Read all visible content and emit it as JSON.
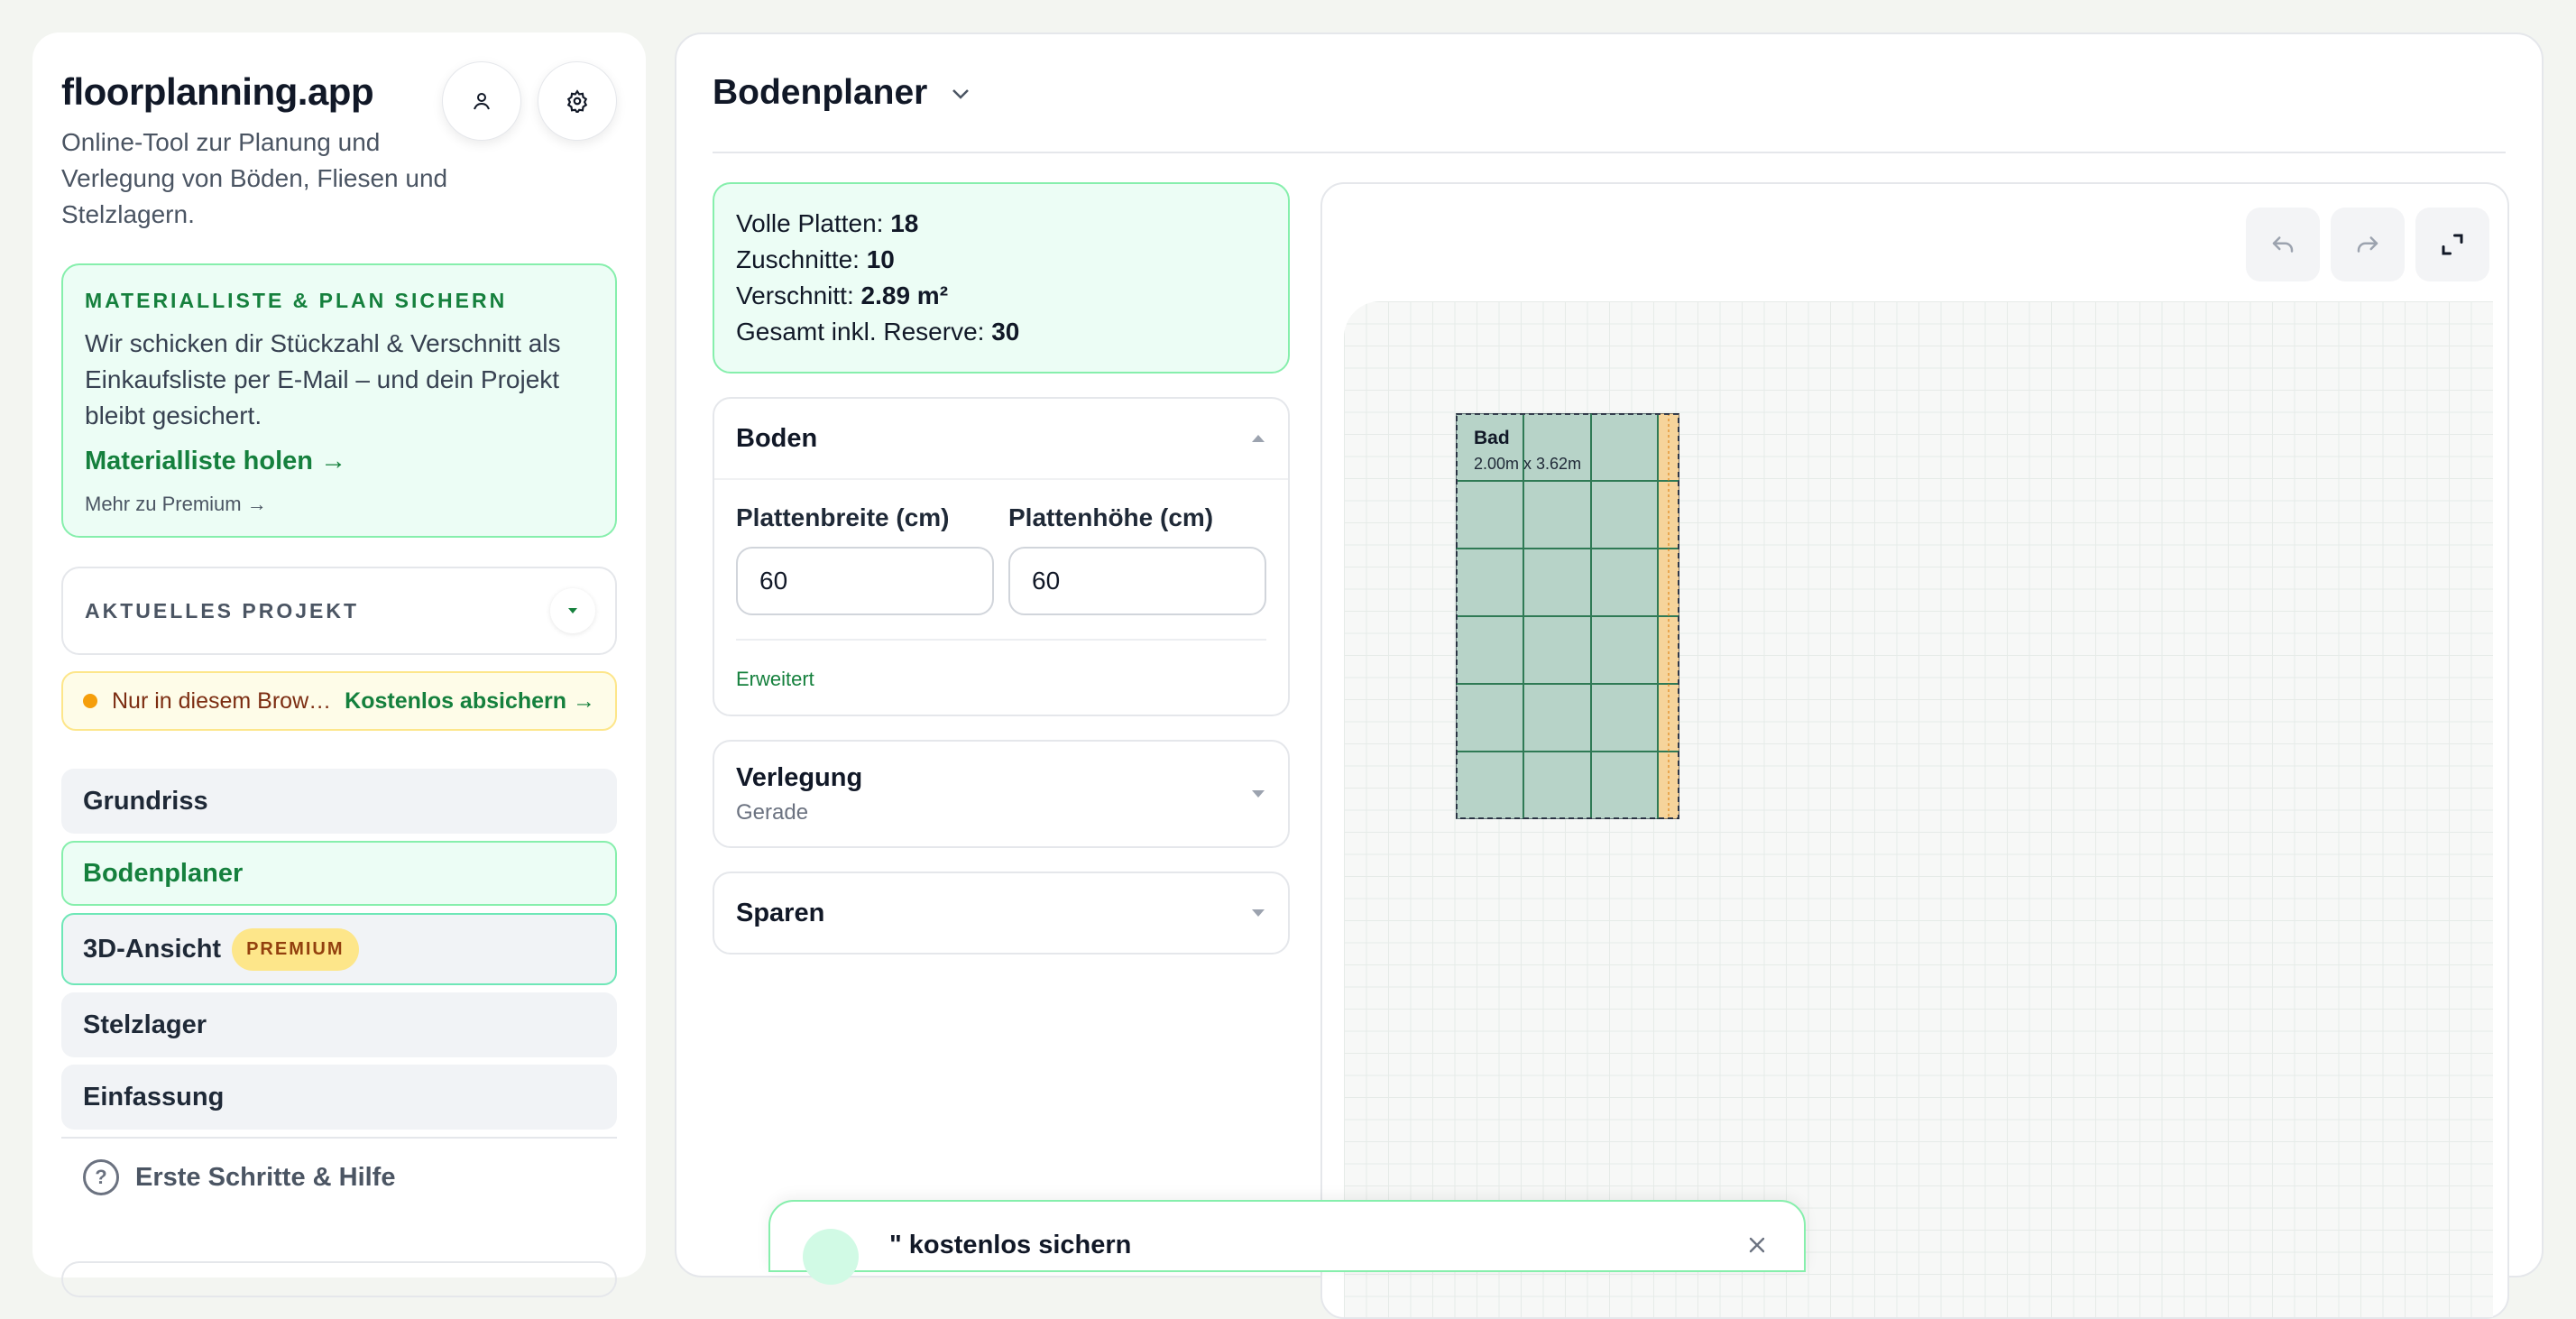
{
  "sidebar": {
    "brand_title": "floorplanning.app",
    "brand_subtitle": "Online-Tool zur Planung und Verlegung von Böden, Fliesen und Stelzlagern.",
    "promo": {
      "title": "MATERIALLISTE & PLAN SICHERN",
      "text": "Wir schicken dir Stückzahl & Verschnitt als Einkaufsliste per E-Mail – und dein Projekt bleibt gesichert.",
      "link": "Materialliste holen →",
      "small_link": "Mehr zu Premium →"
    },
    "project_label": "AKTUELLES PROJEKT",
    "warning": {
      "text": "Nur in diesem Brow…",
      "link": "Kostenlos absichern →"
    },
    "nav": [
      {
        "label": "Grundriss"
      },
      {
        "label": "Bodenplaner"
      },
      {
        "label": "3D-Ansicht",
        "badge": "PREMIUM"
      },
      {
        "label": "Stelzlager"
      },
      {
        "label": "Einfassung"
      }
    ],
    "help": "Erste Schritte & Hilfe"
  },
  "main": {
    "title": "Bodenplaner",
    "stats": {
      "full_label": "Volle Platten:",
      "full_value": "18",
      "cuts_label": "Zuschnitte:",
      "cuts_value": "10",
      "waste_label": "Verschnitt:",
      "waste_value": "2.89 m²",
      "total_label": "Gesamt inkl. Reserve:",
      "total_value": "30"
    },
    "panels": {
      "boden": {
        "title": "Boden",
        "width_label": "Plattenbreite (cm)",
        "width_value": "60",
        "height_label": "Plattenhöhe (cm)",
        "height_value": "60",
        "advanced": "Erweitert"
      },
      "verlegung": {
        "title": "Verlegung",
        "value": "Gerade"
      },
      "sparen": {
        "title": "Sparen"
      }
    },
    "canvas": {
      "room_name": "Bad",
      "room_dims": "2.00m x 3.62m",
      "tile_color": "#b7d3c8",
      "cut_color": "#f6d49b",
      "grid_line_color": "#2f7a55"
    },
    "toast": {
      "text": "\" kostenlos sichern"
    }
  },
  "colors": {
    "accent": "#15803d",
    "accent_bg": "#ecfdf5",
    "accent_border": "#86efac",
    "premium": "#fde68a"
  }
}
